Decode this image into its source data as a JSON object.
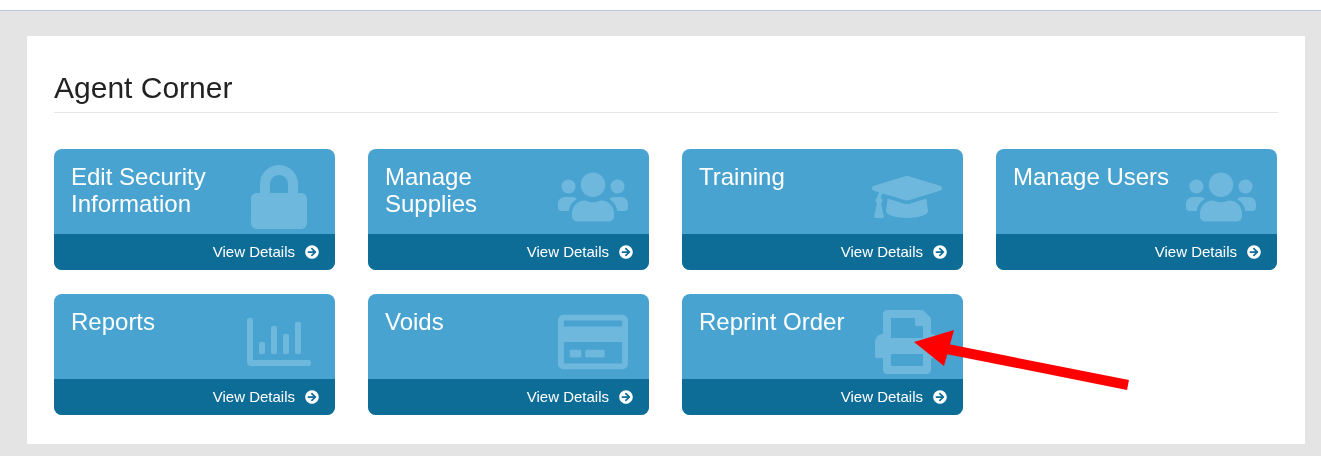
{
  "panel": {
    "title": "Agent Corner"
  },
  "tiles": [
    {
      "title": "Edit Security Information",
      "kind": "lock",
      "link": "View Details"
    },
    {
      "title": "Manage Supplies",
      "kind": "users",
      "link": "View Details"
    },
    {
      "title": "Training",
      "kind": "graduation",
      "link": "View Details"
    },
    {
      "title": "Manage Users",
      "kind": "users",
      "link": "View Details"
    },
    {
      "title": "Reports",
      "kind": "chart",
      "link": "View Details"
    },
    {
      "title": "Voids",
      "kind": "card",
      "link": "View Details"
    },
    {
      "title": "Reprint Order",
      "kind": "printer",
      "link": "View Details"
    }
  ]
}
